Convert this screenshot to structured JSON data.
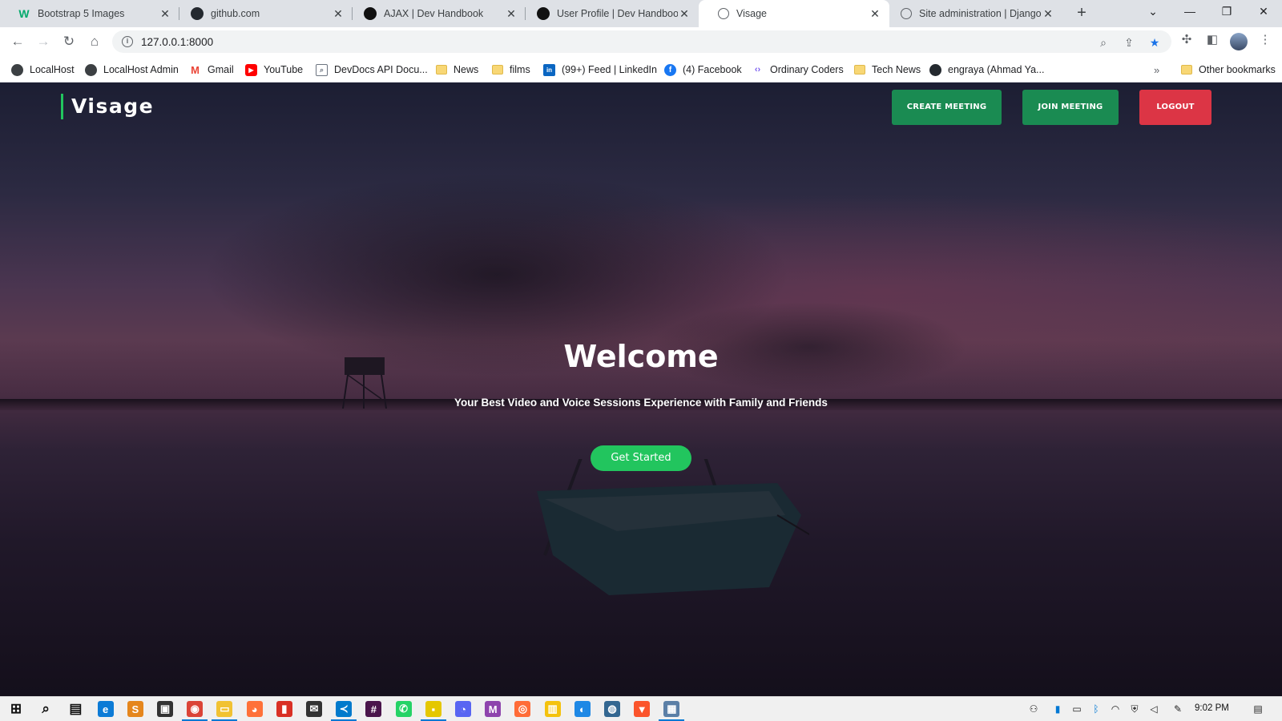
{
  "browser": {
    "tabs": [
      {
        "title": "Bootstrap 5 Images",
        "favicon": "w3schools-icon",
        "color": "#04aa6d",
        "glyph": "W",
        "active": false
      },
      {
        "title": "github.com",
        "favicon": "github-icon",
        "color": "#24292f",
        "glyph": "",
        "active": false
      },
      {
        "title": "AJAX | Dev Handbook",
        "favicon": "devhandbook-icon",
        "color": "#111111",
        "glyph": "",
        "active": false
      },
      {
        "title": "User Profile | Dev Handbook",
        "favicon": "devhandbook-icon",
        "color": "#111111",
        "glyph": "",
        "active": false
      },
      {
        "title": "Visage",
        "favicon": "globe-icon",
        "color": "#5f6368",
        "glyph": "",
        "active": true
      },
      {
        "title": "Site administration | Django s",
        "favicon": "globe-icon",
        "color": "#5f6368",
        "glyph": "",
        "active": false
      }
    ],
    "address_url": "127.0.0.1:8000",
    "bookmarks": [
      {
        "label": "LocalHost",
        "icon": "globe-icon",
        "color": "#3c4043",
        "folder": false
      },
      {
        "label": "LocalHost Admin",
        "icon": "globe-icon",
        "color": "#3c4043",
        "folder": false
      },
      {
        "label": "Gmail",
        "icon": "gmail-icon",
        "color": "#ea4335",
        "folder": false
      },
      {
        "label": "YouTube",
        "icon": "youtube-icon",
        "color": "#ff0000",
        "folder": false
      },
      {
        "label": "DevDocs API Docu...",
        "icon": "devdocs-icon",
        "color": "#6c7480",
        "folder": false
      },
      {
        "label": "News",
        "icon": "folder-icon",
        "color": "#f8d775",
        "folder": true
      },
      {
        "label": "films",
        "icon": "folder-icon",
        "color": "#f8d775",
        "folder": true
      },
      {
        "label": "(99+) Feed | LinkedIn",
        "icon": "linkedin-icon",
        "color": "#0a66c2",
        "folder": false
      },
      {
        "label": "(4) Facebook",
        "icon": "facebook-icon",
        "color": "#1877f2",
        "folder": false
      },
      {
        "label": "Ordinary Coders",
        "icon": "code-icon",
        "color": "#7a5cf0",
        "folder": false
      },
      {
        "label": "Tech News",
        "icon": "folder-icon",
        "color": "#f8d775",
        "folder": true
      },
      {
        "label": "engraya (Ahmad Ya...",
        "icon": "github-icon",
        "color": "#24292f",
        "folder": false
      }
    ],
    "other_bookmarks": "Other bookmarks"
  },
  "site": {
    "brand": "Visage",
    "nav": {
      "create_meeting": "CREATE MEETING",
      "join_meeting": "JOIN MEETING",
      "logout": "LOGOUT"
    },
    "hero": {
      "heading": "Welcome",
      "tagline": "Your Best Video and Voice Sessions Experience with Family and Friends",
      "cta": "Get Started"
    },
    "colors": {
      "accent_green": "#22c55e",
      "button_green": "#1a8b52",
      "logout_red": "#dc3545"
    }
  },
  "taskbar": {
    "apps": [
      {
        "name": "start-button",
        "glyph": "⊞",
        "color": "#111111",
        "running": false
      },
      {
        "name": "search-icon",
        "glyph": "⌕",
        "color": "#111111",
        "running": false
      },
      {
        "name": "task-view-icon",
        "glyph": "▤",
        "color": "#111111",
        "running": false
      },
      {
        "name": "edge-icon",
        "glyph": "e",
        "color": "#0c7bd6",
        "running": false
      },
      {
        "name": "sublime-icon",
        "glyph": "S",
        "color": "#e5861c",
        "running": false
      },
      {
        "name": "store-icon",
        "glyph": "▣",
        "color": "#333333",
        "running": false
      },
      {
        "name": "chrome-icon",
        "glyph": "◉",
        "color": "#db4437",
        "running": true
      },
      {
        "name": "file-explorer-icon",
        "glyph": "▭",
        "color": "#f1c232",
        "running": true
      },
      {
        "name": "firefox-icon",
        "glyph": "◕",
        "color": "#ff7139",
        "running": false
      },
      {
        "name": "app-red-icon",
        "glyph": "▮",
        "color": "#d93025",
        "running": false
      },
      {
        "name": "mail-icon",
        "glyph": "✉",
        "color": "#333333",
        "running": false
      },
      {
        "name": "vscode-icon",
        "glyph": "≺",
        "color": "#007acc",
        "running": true
      },
      {
        "name": "slack-icon",
        "glyph": "#",
        "color": "#4a154b",
        "running": false
      },
      {
        "name": "whatsapp-icon",
        "glyph": "✆",
        "color": "#25d366",
        "running": false
      },
      {
        "name": "sticky-notes-icon",
        "glyph": "▪",
        "color": "#e5c700",
        "running": true
      },
      {
        "name": "discord-icon",
        "glyph": "◔",
        "color": "#5865f2",
        "running": false
      },
      {
        "name": "media-icon",
        "glyph": "M",
        "color": "#8e44ad",
        "running": false
      },
      {
        "name": "postman-icon",
        "glyph": "◎",
        "color": "#ff6c37",
        "running": false
      },
      {
        "name": "notes-icon",
        "glyph": "▥",
        "color": "#f4c20d",
        "running": false
      },
      {
        "name": "edge-beta-icon",
        "glyph": "◐",
        "color": "#1e88e5",
        "running": false
      },
      {
        "name": "postgres-icon",
        "glyph": "◍",
        "color": "#336791",
        "running": false
      },
      {
        "name": "brave-icon",
        "glyph": "▼",
        "color": "#fb542b",
        "running": false
      },
      {
        "name": "screen-app-icon",
        "glyph": "▦",
        "color": "#5b7fa6",
        "running": true
      }
    ],
    "clock": "9:02 PM"
  }
}
